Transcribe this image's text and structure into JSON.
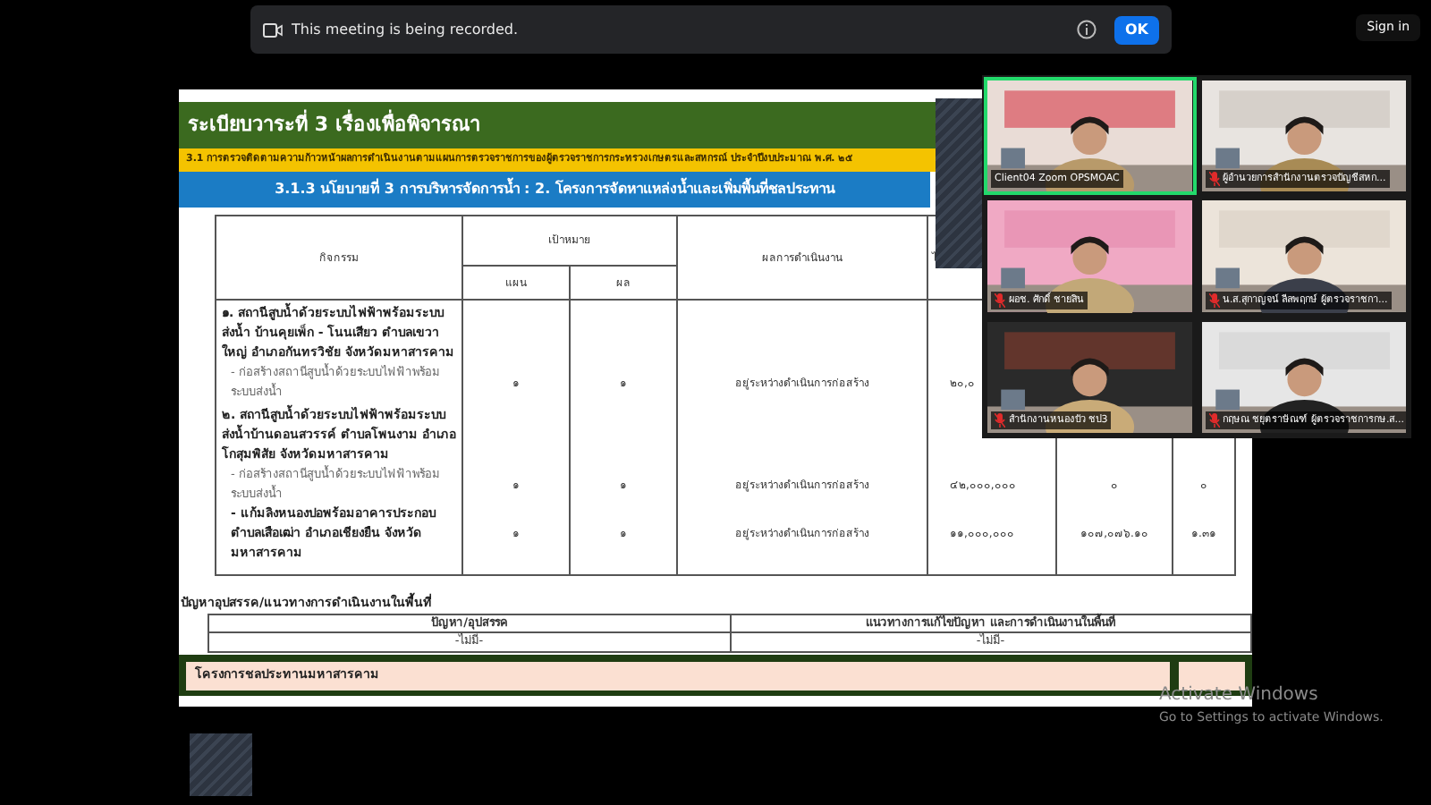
{
  "banner": {
    "message": "This meeting is being recorded.",
    "button": "OK"
  },
  "sign_in": "Sign in",
  "slide": {
    "title": "ระเบียบวาระที่ 3 เรื่องเพื่อพิจารณา",
    "subtitle": "3.1 การตรวจติดตามความก้าวหน้าผลการดำเนินงานตามแผนการตรวจราชการของผู้ตรวจราชการกระทรวงเกษตรและสหกรณ์ ประจำปีงบประมาณ พ.ศ. ๒๕",
    "section": "3.1.3 นโยบายที่ 3 การบริหารจัดการน้ำ : 2. โครงการจัดหาแหล่งน้ำและเพิ่มพื้นที่ชลประทาน",
    "table": {
      "activity": "กิจกรรม",
      "target": "เป้าหมาย",
      "plan": "แผน",
      "result": "ผล",
      "status": "ผลการดำเนินงาน",
      "column_5": "ไ",
      "rows": [
        {
          "kind": "heading",
          "text": "๑. สถานีสูบน้ำด้วยระบบไฟฟ้าพร้อมระบบส่งน้ำ บ้านคุยเพ็ก - โนนเสียว ตำบลเขวาใหญ่ อำเภอกันทรวิชัย จังหวัดมหาสารคาม"
        },
        {
          "kind": "item",
          "bold": false,
          "text": "- ก่อสร้างสถานีสูบน้ำด้วยระบบไฟฟ้าพร้อมระบบส่งน้ำ",
          "plan": "๑",
          "result": "๑",
          "status": "อยู่ระหว่างดำเนินการก่อสร้าง",
          "column_5": "๒๐,๐"
        },
        {
          "kind": "heading",
          "text": "๒. สถานีสูบน้ำด้วยระบบไฟฟ้าพร้อมระบบส่งน้ำบ้านดอนสวรรค์ ตำบลโพนงาม อำเภอโกสุมพิสัย จังหวัดมหาสารคาม"
        },
        {
          "kind": "item",
          "bold": false,
          "text": "- ก่อสร้างสถานีสูบน้ำด้วยระบบไฟฟ้าพร้อมระบบส่งน้ำ",
          "plan": "๑",
          "result": "๑",
          "status": "อยู่ระหว่างดำเนินการก่อสร้าง",
          "column_5": "๔๒,๐๐๐,๐๐๐",
          "column_6": "๐",
          "column_7": "๐"
        },
        {
          "kind": "item",
          "bold": true,
          "text": "- แก้มลิงหนองปอพร้อมอาคารประกอบ ตำบลเสือเฒ่า อำเภอเชียงยืน จังหวัดมหาสารคาม",
          "plan": "๑",
          "result": "๑",
          "status": "อยู่ระหว่างดำเนินการก่อสร้าง",
          "column_5": "๑๑,๐๐๐,๐๐๐",
          "column_6": "๑๐๗,๐๗๖.๑๐",
          "column_7": "๑.๓๑"
        }
      ]
    },
    "issues": {
      "title": "ปัญหาอุปสรรค/แนวทางการดำเนินงานในพื้นที่",
      "columns": [
        "ปัญหา/อุปสรรค",
        "แนวทางการแก้ไขปัญหา และการดำเนินงานในพื้นที่"
      ],
      "cells": [
        "-ไม่มี-",
        "-ไม่มี-"
      ]
    },
    "footer": {
      "project": "โครงการชลประทานมหาสารคาม"
    }
  },
  "gallery": [
    {
      "name": "Client04 Zoom OPSMOAC",
      "muted": false,
      "active": true
    },
    {
      "name": "ผู้อำนวยการสำนักงานตรวจบัญชีสหก...",
      "muted": true,
      "active": false
    },
    {
      "name": "ผอช. ศักดิ์ ชายสิน",
      "muted": true,
      "active": false
    },
    {
      "name": "น.ส.สุกาญจน์ ลีลพฤกษ์ ผู้ตรวจราชกา...",
      "muted": true,
      "active": false
    },
    {
      "name": "สำนักงานหนองบัว ชป3",
      "muted": true,
      "active": false
    },
    {
      "name": "กฤษณ ชยุตราษัณฑ์ ผู้ตรวจราชการกษ.ส...",
      "muted": true,
      "active": false
    }
  ],
  "windows_notice": {
    "title": "Activate Windows",
    "subtitle": "Go to Settings to activate Windows."
  }
}
